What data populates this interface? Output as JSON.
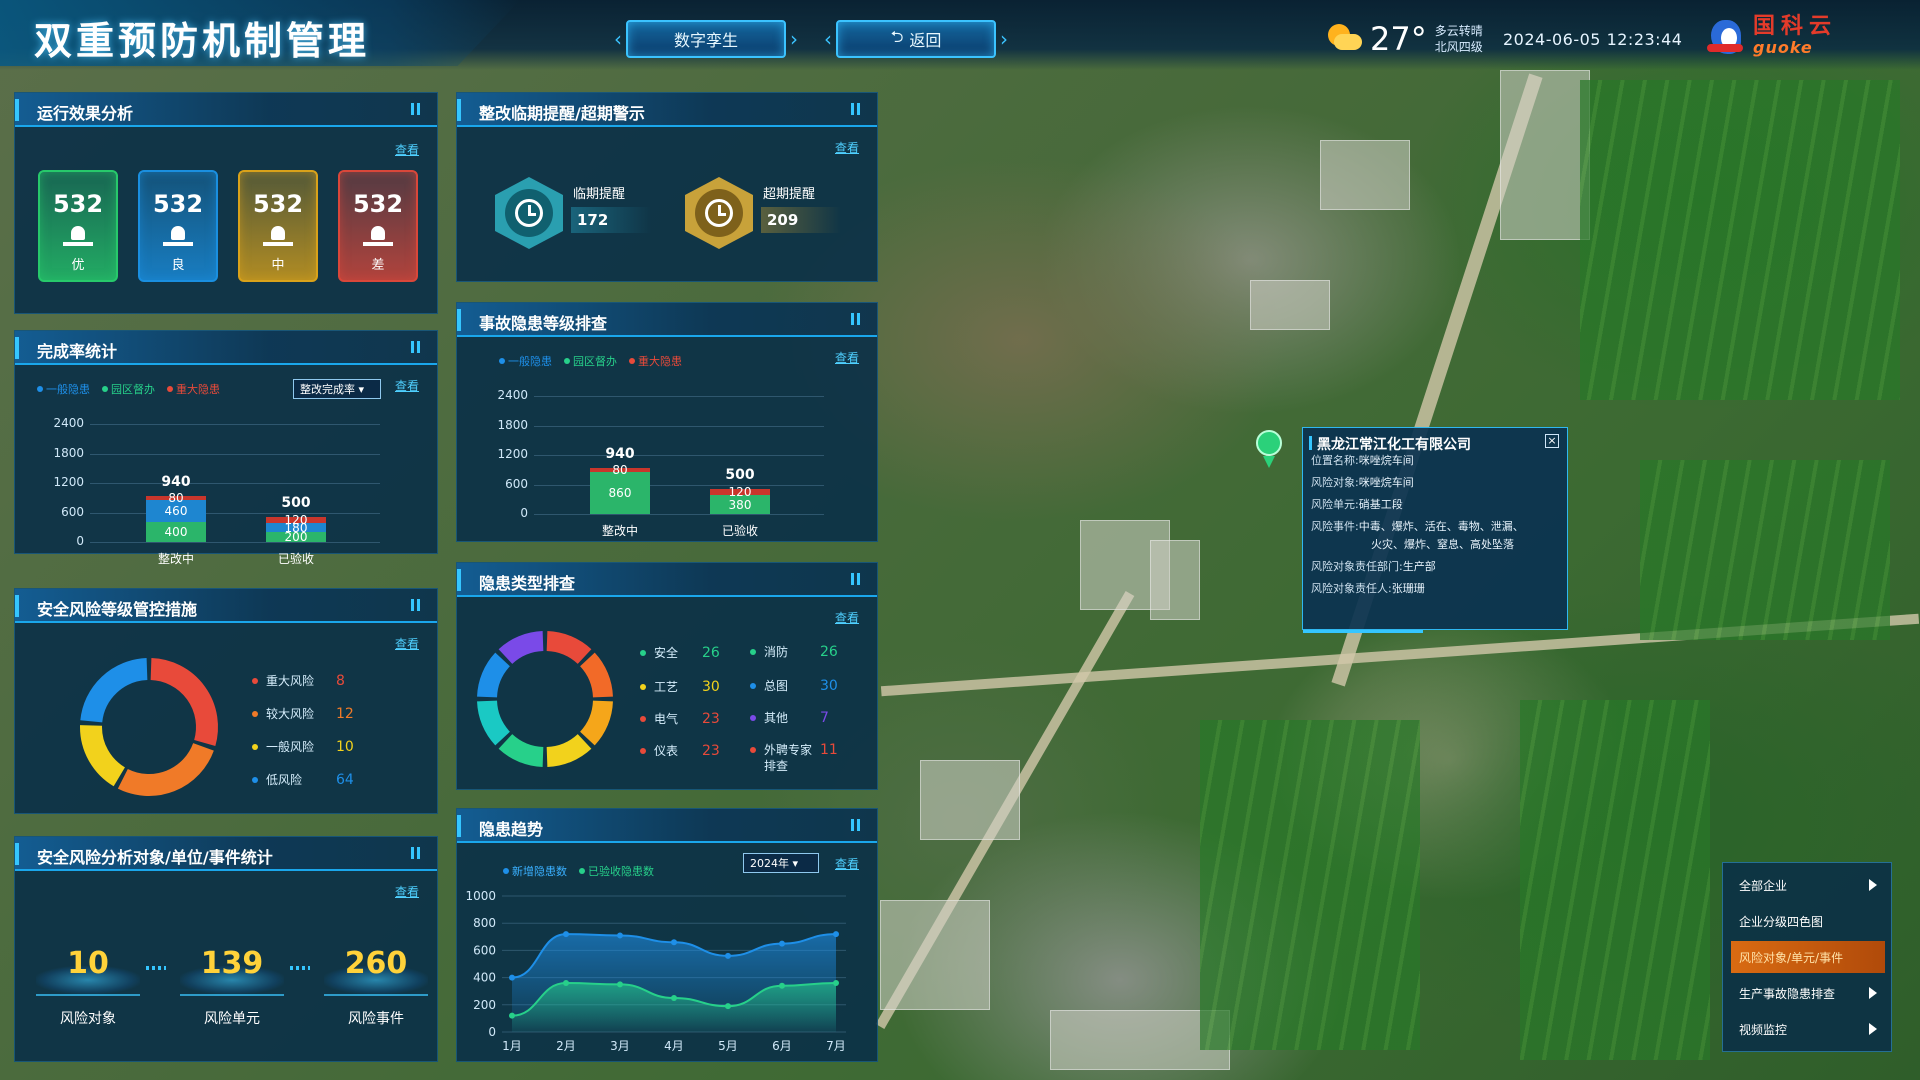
{
  "header": {
    "title": "双重预防机制管理",
    "digital_twin_btn": "数字孪生",
    "back_btn": "返回",
    "back_icon": "undo-arrow-icon",
    "weather": {
      "temperature": "27°",
      "condition": "多云转晴",
      "wind": "北风四级",
      "icon": "sun-cloud-icon"
    },
    "datetime": "2024-06-05 12:23:44",
    "logo_text": "国科云",
    "logo_sub": "guoke"
  },
  "look_label": "查看",
  "effect": {
    "title": "运行效果分析",
    "cards": [
      {
        "value": "532",
        "label": "优",
        "color": "#27c96b"
      },
      {
        "value": "532",
        "label": "良",
        "color": "#1a8fe0"
      },
      {
        "value": "532",
        "label": "中",
        "color": "#d9a21a"
      },
      {
        "value": "532",
        "label": "差",
        "color": "#d9473a"
      }
    ]
  },
  "completion": {
    "title": "完成率统计",
    "legend": [
      "一般隐患",
      "园区督办",
      "重大隐患"
    ],
    "select_value": "整改完成率",
    "y_ticks": [
      "2400",
      "1800",
      "1200",
      "600",
      "0"
    ],
    "categories": [
      "整改中",
      "已验收"
    ],
    "totals": [
      "940",
      "500"
    ],
    "segments": [
      {
        "bottom": "400",
        "middle": "460",
        "top": "80"
      },
      {
        "bottom": "200",
        "middle": "180",
        "top": "120"
      }
    ]
  },
  "risk_level": {
    "title": "安全风险等级管控措施",
    "items": [
      {
        "name": "重大风险",
        "value": "8",
        "color": "#e84a3a"
      },
      {
        "name": "较大风险",
        "value": "12",
        "color": "#f07a28"
      },
      {
        "name": "一般风险",
        "value": "10",
        "color": "#f2d21c"
      },
      {
        "name": "低风险",
        "value": "64",
        "color": "#1e8fe8"
      }
    ]
  },
  "analysis": {
    "title": "安全风险分析对象/单位/事件统计",
    "items": [
      {
        "value": "10",
        "label": "风险对象"
      },
      {
        "value": "139",
        "label": "风险单元"
      },
      {
        "value": "260",
        "label": "风险事件"
      }
    ]
  },
  "deadline": {
    "title": "整改临期提醒/超期警示",
    "near": {
      "label": "临期提醒",
      "value": "172"
    },
    "over": {
      "label": "超期提醒",
      "value": "209"
    }
  },
  "accident": {
    "title": "事故隐患等级排查",
    "legend": [
      "一般隐患",
      "园区督办",
      "重大隐患"
    ],
    "y_ticks": [
      "2400",
      "1800",
      "1200",
      "600",
      "0"
    ],
    "categories": [
      "整改中",
      "已验收"
    ],
    "totals": [
      "940",
      "500"
    ],
    "segments": [
      {
        "bottom": "860",
        "top": "80"
      },
      {
        "bottom": "380",
        "top": "120"
      }
    ]
  },
  "hazard_types": {
    "title": "隐患类型排查",
    "left": [
      {
        "name": "安全",
        "value": "26",
        "color": "#27d08a"
      },
      {
        "name": "工艺",
        "value": "30",
        "color": "#f2d21c"
      },
      {
        "name": "电气",
        "value": "23",
        "color": "#e84a3a"
      },
      {
        "name": "仪表",
        "value": "23",
        "color": "#e84a3a"
      }
    ],
    "right": [
      {
        "name": "消防",
        "value": "26",
        "color": "#27d08a"
      },
      {
        "name": "总图",
        "value": "30",
        "color": "#1e8fe8"
      },
      {
        "name": "其他",
        "value": "7",
        "color": "#7a4ae8"
      },
      {
        "name": "外聘专家排查",
        "value": "11",
        "color": "#e84a3a"
      }
    ]
  },
  "trend": {
    "title": "隐患趋势",
    "legend": [
      "新增隐患数",
      "已验收隐患数"
    ],
    "select_value": "2024年",
    "y_ticks": [
      "1000",
      "800",
      "600",
      "400",
      "200",
      "0"
    ],
    "months": [
      "1月",
      "2月",
      "3月",
      "4月",
      "5月",
      "6月",
      "7月"
    ]
  },
  "chart_data": [
    {
      "type": "bar",
      "title": "完成率统计",
      "categories": [
        "整改中",
        "已验收"
      ],
      "series": [
        {
          "name": "一般隐患",
          "values": [
            400,
            200
          ]
        },
        {
          "name": "园区督办",
          "values": [
            460,
            180
          ]
        },
        {
          "name": "重大隐患",
          "values": [
            80,
            120
          ]
        }
      ],
      "ylim": [
        0,
        2400
      ]
    },
    {
      "type": "bar",
      "title": "事故隐患等级排查",
      "categories": [
        "整改中",
        "已验收"
      ],
      "series": [
        {
          "name": "一般隐患",
          "values": [
            860,
            380
          ]
        },
        {
          "name": "重大隐患",
          "values": [
            80,
            120
          ]
        }
      ],
      "ylim": [
        0,
        2400
      ]
    },
    {
      "type": "pie",
      "title": "安全风险等级管控措施",
      "categories": [
        "重大风险",
        "较大风险",
        "一般风险",
        "低风险"
      ],
      "values": [
        8,
        12,
        10,
        64
      ]
    },
    {
      "type": "pie",
      "title": "隐患类型排查",
      "categories": [
        "安全",
        "工艺",
        "电气",
        "仪表",
        "消防",
        "总图",
        "其他",
        "外聘专家排查"
      ],
      "values": [
        26,
        30,
        23,
        23,
        26,
        30,
        7,
        11
      ]
    },
    {
      "type": "area",
      "title": "隐患趋势",
      "x": [
        "1月",
        "2月",
        "3月",
        "4月",
        "5月",
        "6月",
        "7月"
      ],
      "series": [
        {
          "name": "新增隐患数",
          "values": [
            400,
            720,
            710,
            660,
            560,
            650,
            720
          ]
        },
        {
          "name": "已验收隐患数",
          "values": [
            120,
            360,
            350,
            250,
            190,
            340,
            360
          ]
        }
      ],
      "ylim": [
        0,
        1000
      ]
    }
  ],
  "popup": {
    "title": "黑龙江常江化工有限公司",
    "rows": [
      {
        "k": "位置名称:",
        "v": "咪唑烷车间"
      },
      {
        "k": "风险对象:",
        "v": "咪唑烷车间"
      },
      {
        "k": "风险单元:",
        "v": "硝基工段"
      },
      {
        "k": "风险事件:",
        "v": "中毒、爆炸、活在、毒物、泄漏、"
      },
      {
        "k": "",
        "v": "火灾、爆炸、窒息、高处坠落"
      },
      {
        "k": "风险对象责任部门:",
        "v": "生产部"
      },
      {
        "k": "风险对象责任人:",
        "v": "张珊珊"
      }
    ]
  },
  "right_menu": [
    {
      "label": "全部企业",
      "arrow": true,
      "active": false
    },
    {
      "label": "企业分级四色图",
      "arrow": false,
      "active": false
    },
    {
      "label": "风险对象/单元/事件",
      "arrow": false,
      "active": true
    },
    {
      "label": "生产事故隐患排查",
      "arrow": true,
      "active": false
    },
    {
      "label": "视频监控",
      "arrow": true,
      "active": false
    }
  ]
}
